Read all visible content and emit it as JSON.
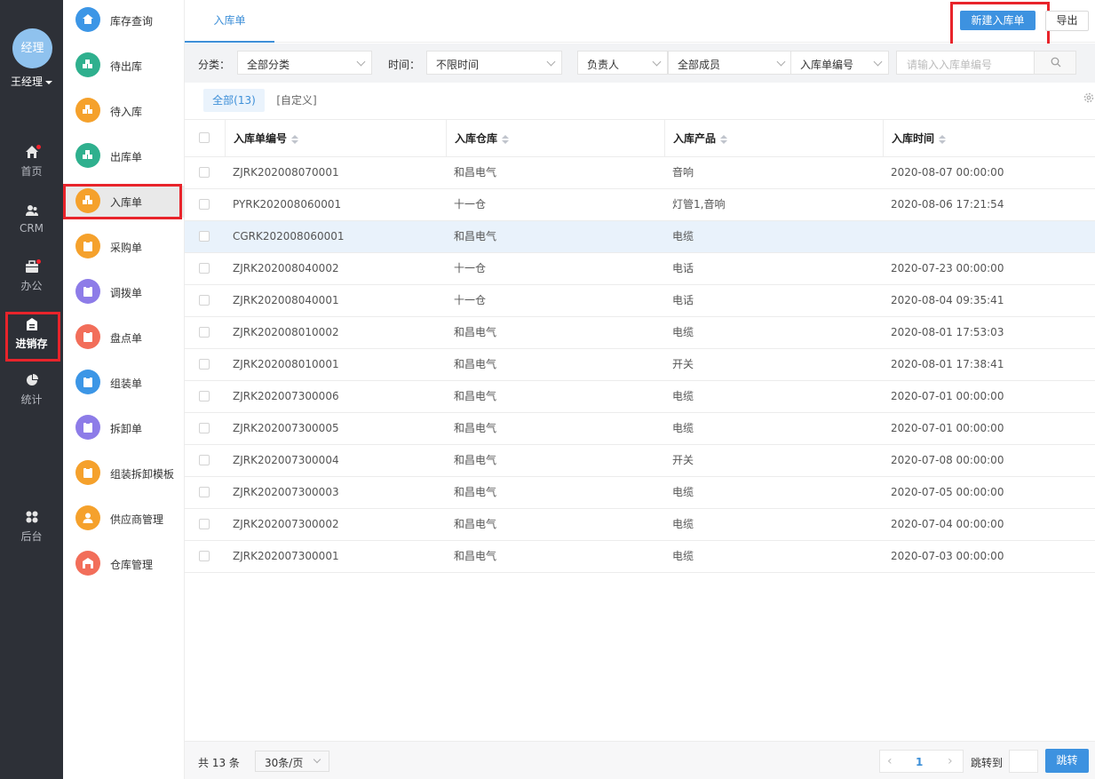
{
  "nav": {
    "avatar_text": "经理",
    "user_name": "王经理",
    "items": [
      {
        "label": "首页",
        "icon": "home-icon",
        "badge": true
      },
      {
        "label": "CRM",
        "icon": "users-icon",
        "badge": false
      },
      {
        "label": "办公",
        "icon": "briefcase-icon",
        "badge": true
      },
      {
        "label": "进销存",
        "icon": "inventory-icon",
        "badge": false,
        "active": true
      },
      {
        "label": "统计",
        "icon": "pie-chart-icon",
        "badge": false
      },
      {
        "label": "后台",
        "icon": "grid-icon",
        "badge": false
      }
    ]
  },
  "submenu": {
    "items": [
      {
        "label": "库存查询",
        "icon": "home-icon",
        "color": "#3c96e6"
      },
      {
        "label": "待出库",
        "icon": "boxes-icon",
        "color": "#2fb08e"
      },
      {
        "label": "待入库",
        "icon": "boxes-icon",
        "color": "#f5a12c"
      },
      {
        "label": "出库单",
        "icon": "boxes-icon",
        "color": "#2fb08e"
      },
      {
        "label": "入库单",
        "icon": "boxes-icon",
        "color": "#f5a12c",
        "active": true
      },
      {
        "label": "采购单",
        "icon": "clipboard-icon",
        "color": "#f5a12c"
      },
      {
        "label": "调拨单",
        "icon": "clipboard-icon",
        "color": "#8d7ce8"
      },
      {
        "label": "盘点单",
        "icon": "clipboard-icon",
        "color": "#f26e5a"
      },
      {
        "label": "组装单",
        "icon": "clipboard-icon",
        "color": "#3c96e6"
      },
      {
        "label": "拆卸单",
        "icon": "clipboard-icon",
        "color": "#8d7ce8"
      },
      {
        "label": "组装拆卸模板",
        "icon": "clipboard-icon",
        "color": "#f5a12c"
      },
      {
        "label": "供应商管理",
        "icon": "person-icon",
        "color": "#f5a12c"
      },
      {
        "label": "仓库管理",
        "icon": "warehouse-icon",
        "color": "#f26e5a"
      }
    ]
  },
  "header": {
    "tab": "入库单",
    "new_button": "新建入库单",
    "export_button": "导出"
  },
  "filters": {
    "category_label": "分类：",
    "category_value": "全部分类",
    "time_label": "时间：",
    "time_value": "不限时间",
    "owner_value": "负责人",
    "member_value": "全部成员",
    "field_value": "入库单编号",
    "search_placeholder": "请输入入库单编号"
  },
  "segments": {
    "all": "全部(13)",
    "custom": "[自定义]"
  },
  "table": {
    "columns": [
      "入库单编号",
      "入库仓库",
      "入库产品",
      "入库时间"
    ],
    "rows": [
      [
        "ZJRK202008070001",
        "和昌电气",
        "音响",
        "2020-08-07 00:00:00"
      ],
      [
        "PYRK202008060001",
        "十一仓",
        "灯管1,音响",
        "2020-08-06 17:21:54"
      ],
      [
        "CGRK202008060001",
        "和昌电气",
        "电缆",
        ""
      ],
      [
        "ZJRK202008040002",
        "十一仓",
        "电话",
        "2020-07-23 00:00:00"
      ],
      [
        "ZJRK202008040001",
        "十一仓",
        "电话",
        "2020-08-04 09:35:41"
      ],
      [
        "ZJRK202008010002",
        "和昌电气",
        "电缆",
        "2020-08-01 17:53:03"
      ],
      [
        "ZJRK202008010001",
        "和昌电气",
        "开关",
        "2020-08-01 17:38:41"
      ],
      [
        "ZJRK202007300006",
        "和昌电气",
        "电缆",
        "2020-07-01 00:00:00"
      ],
      [
        "ZJRK202007300005",
        "和昌电气",
        "电缆",
        "2020-07-01 00:00:00"
      ],
      [
        "ZJRK202007300004",
        "和昌电气",
        "开关",
        "2020-07-08 00:00:00"
      ],
      [
        "ZJRK202007300003",
        "和昌电气",
        "电缆",
        "2020-07-05 00:00:00"
      ],
      [
        "ZJRK202007300002",
        "和昌电气",
        "电缆",
        "2020-07-04 00:00:00"
      ],
      [
        "ZJRK202007300001",
        "和昌电气",
        "电缆",
        "2020-07-03 00:00:00"
      ]
    ],
    "selected_row": 2
  },
  "footer": {
    "total": "共 13 条",
    "page_size": "30条/页",
    "current_page": "1",
    "jump_label": "跳转到",
    "jump_button": "跳转"
  },
  "colors": {
    "accent": "#3d92e0",
    "nav_bg": "#2d3037",
    "highlight_box": "#e8242b"
  }
}
